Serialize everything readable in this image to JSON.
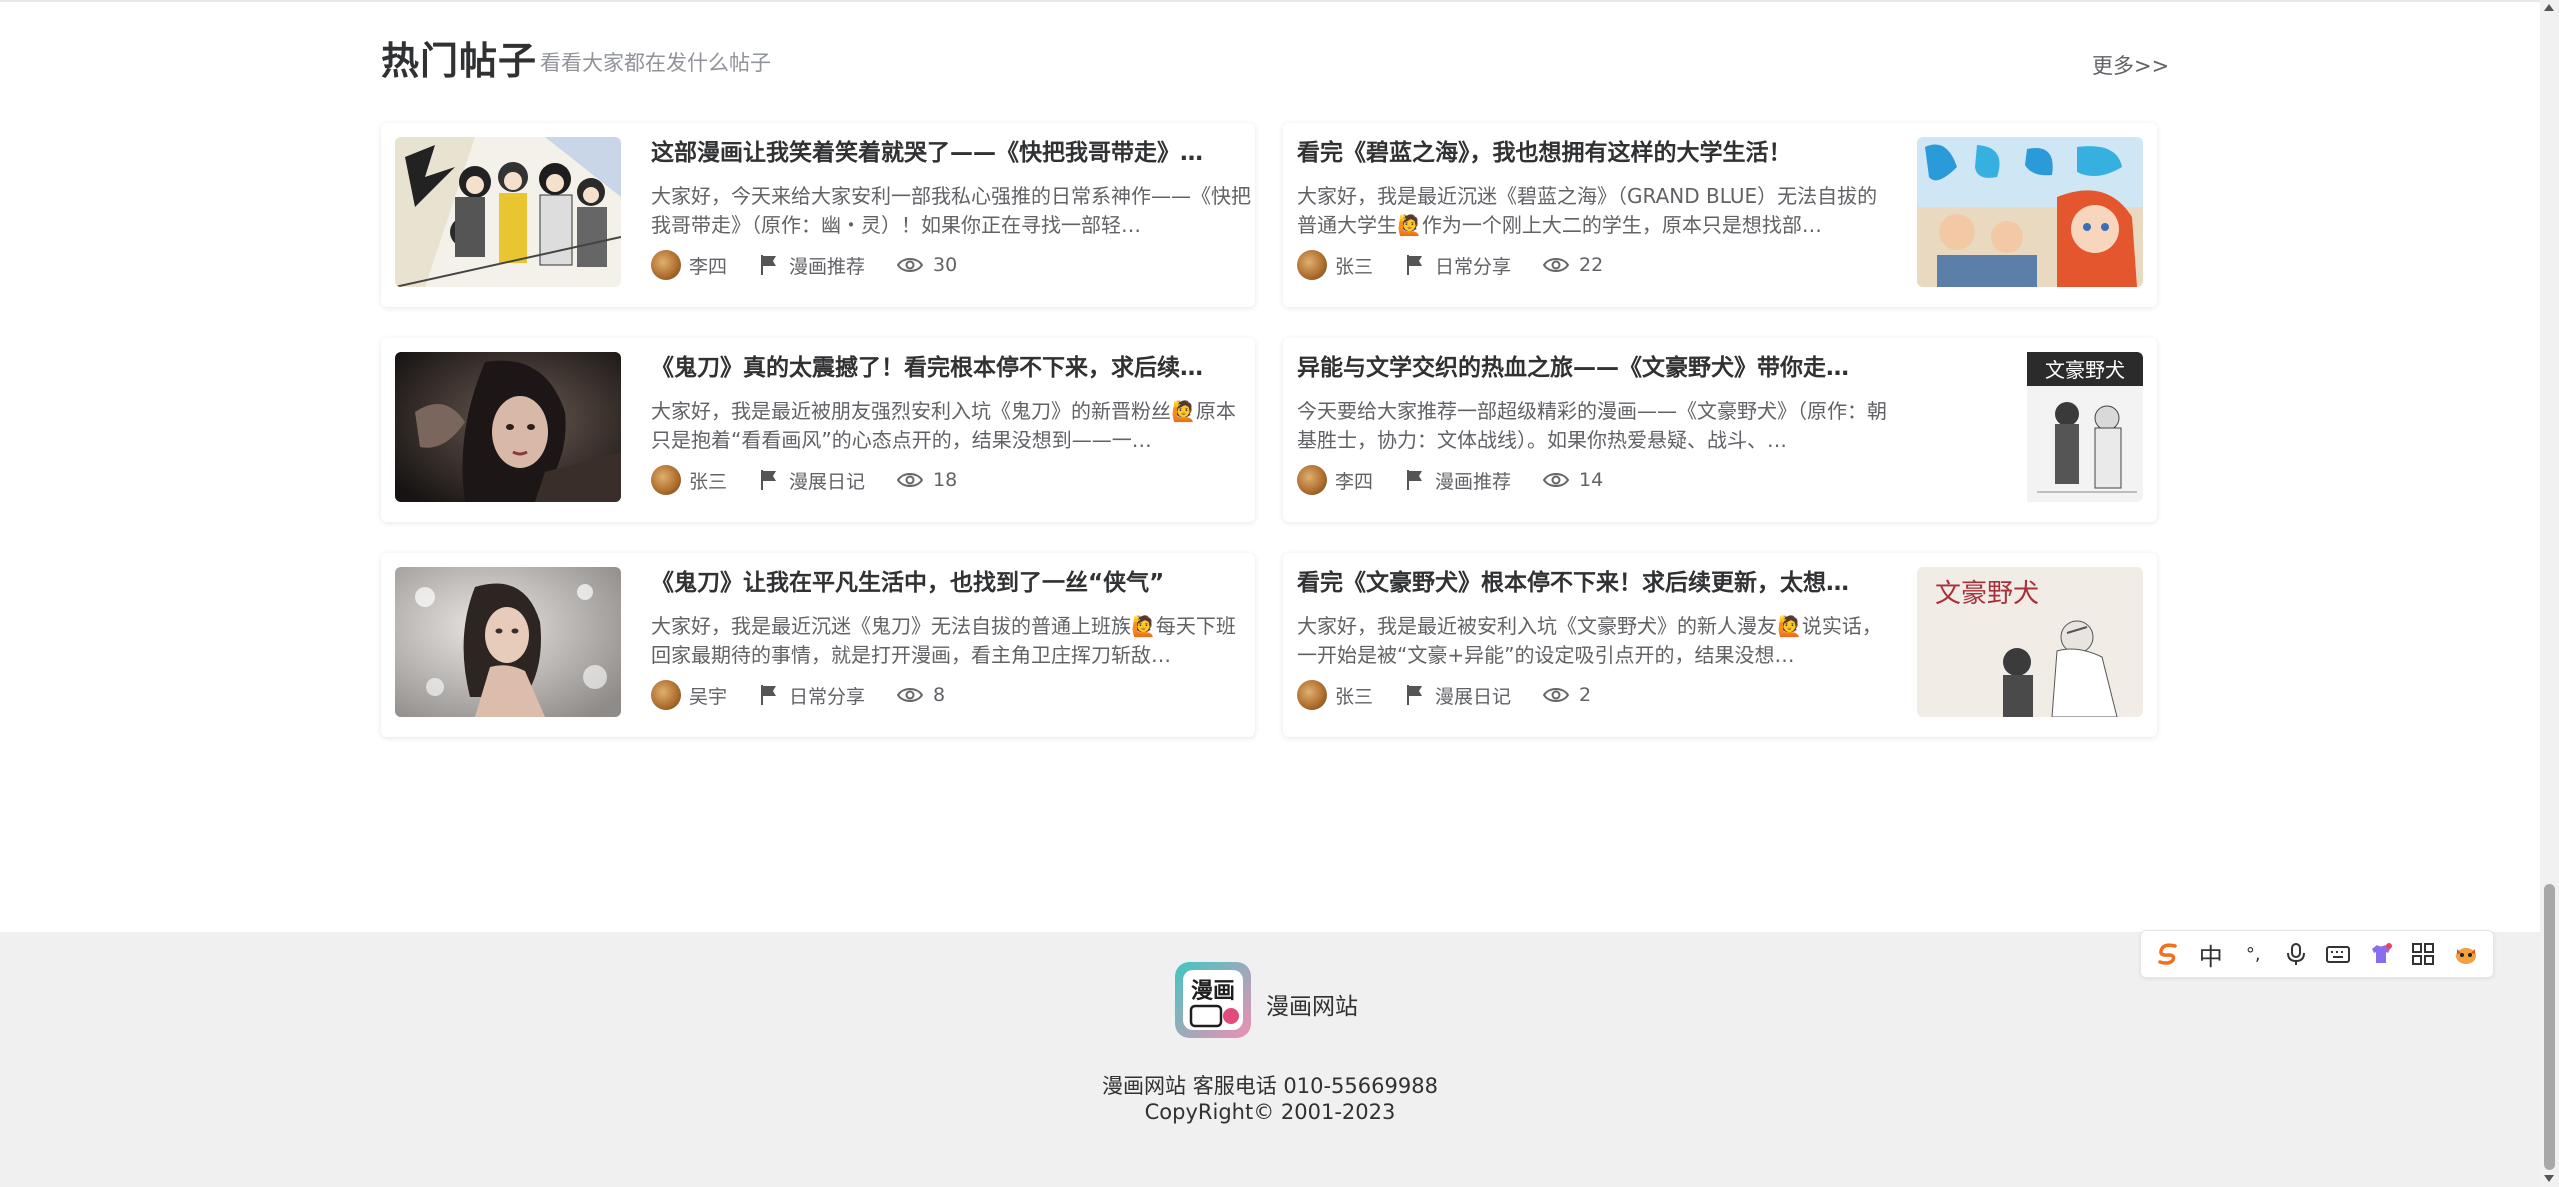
{
  "section": {
    "title": "热门帖子",
    "subtitle": "看看大家都在发什么帖子",
    "more": "更多>>"
  },
  "posts": [
    {
      "title": "这部漫画让我笑着笑着就哭了——《快把我哥带走》…",
      "desc": "大家好，今天来给大家安利一部我私心强推的日常系神作——《快把我哥带走》（原作：幽・灵）！如果你正在寻找一部轻…",
      "author": "李四",
      "category": "漫画推荐",
      "views": "30"
    },
    {
      "title": "看完《碧蓝之海》，我也想拥有这样的大学生活！",
      "desc": "大家好，我是最近沉迷《碧蓝之海》（GRAND BLUE）无法自拔的普通大学生🙋作为一个刚上大二的学生，原本只是想找部…",
      "author": "张三",
      "category": "日常分享",
      "views": "22"
    },
    {
      "title": "《鬼刀》真的太震撼了！看完根本停不下来，求后续…",
      "desc": "大家好，我是最近被朋友强烈安利入坑《鬼刀》的新晋粉丝🙋原本只是抱着“看看画风”的心态点开的，结果没想到——一…",
      "author": "张三",
      "category": "漫展日记",
      "views": "18"
    },
    {
      "title": "异能与文学交织的热血之旅——《文豪野犬》带你走…",
      "desc": "今天要给大家推荐一部超级精彩的漫画——《文豪野犬》（原作：朝基胜士，协力：文体战线）。如果你热爱悬疑、战斗、…",
      "author": "李四",
      "category": "漫画推荐",
      "views": "14"
    },
    {
      "title": "《鬼刀》让我在平凡生活中，也找到了一丝“侠气”",
      "desc": "大家好，我是最近沉迷《鬼刀》无法自拔的普通上班族🙋每天下班回家最期待的事情，就是打开漫画，看主角卫庄挥刀斩敌…",
      "author": "吴宇",
      "category": "日常分享",
      "views": "8"
    },
    {
      "title": "看完《文豪野犬》根本停不下来！求后续更新，太想…",
      "desc": "大家好，我是最近被安利入坑《文豪野犬》的新人漫友🙋说实话，一开始是被“文豪+异能”的设定吸引点开的，结果没想…",
      "author": "张三",
      "category": "漫展日记",
      "views": "2"
    }
  ],
  "thumbnails": {
    "post4_cover_text": "文豪野犬",
    "post6_cover_text": "文豪野犬"
  },
  "footer": {
    "logo_text": "漫画",
    "site_name": "漫画网站",
    "contact": "漫画网站 客服电话 010-55669988",
    "copyright": "CopyRight© 2001-2023"
  },
  "ime": {
    "lang": "中",
    "punct": "°,"
  },
  "colors": {
    "title": "#303133",
    "text": "#606266",
    "muted": "#909399",
    "footer_bg": "#f0f0f0",
    "ime_logo": "#f07020"
  }
}
